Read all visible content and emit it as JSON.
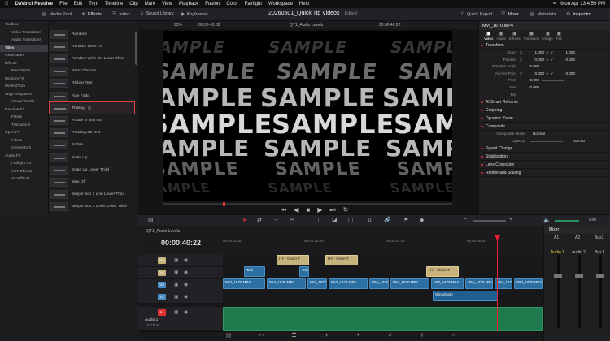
{
  "menubar": {
    "app": "DaVinci Resolve",
    "items": [
      "File",
      "Edit",
      "Trim",
      "Timeline",
      "Clip",
      "Mark",
      "View",
      "Playback",
      "Fusion",
      "Color",
      "Fairlight",
      "Workspace",
      "Help"
    ],
    "datetime": "Mon Apr 13  4:59 PM"
  },
  "toolbar": {
    "media_pool": "Media Pool",
    "effects": "Effects",
    "index": "Index",
    "sound_library": "Sound Library",
    "keyframes": "Keyframes",
    "project": "20260501_Quick Tip Videos",
    "edited": "Edited",
    "quick_export": "Quick Export",
    "mixer": "Mixer",
    "metadata": "Metadata",
    "inspector": "Inspector"
  },
  "fx_tree": [
    {
      "label": "Toolbox",
      "sub": false,
      "sel": false
    },
    {
      "label": "Video Transitions",
      "sub": true,
      "sel": false
    },
    {
      "label": "Audio Transitions",
      "sub": true,
      "sel": false
    },
    {
      "label": "Titles",
      "sub": false,
      "sel": true
    },
    {
      "label": "Generators",
      "sub": false,
      "sel": false
    },
    {
      "label": "Effects",
      "sub": false,
      "sel": false
    },
    {
      "label": "Brenderize",
      "sub": true,
      "sel": false
    },
    {
      "label": "MotionVFX",
      "sub": false,
      "sel": false
    },
    {
      "label": "MoTextTurn",
      "sub": false,
      "sel": false
    },
    {
      "label": "WippTemplates",
      "sub": false,
      "sel": false
    },
    {
      "label": "Visual Words",
      "sub": true,
      "sel": false
    },
    {
      "label": "Resolve FX",
      "sub": false,
      "sel": false
    },
    {
      "label": "Filters",
      "sub": true,
      "sel": false
    },
    {
      "label": "Transitions",
      "sub": true,
      "sel": false
    },
    {
      "label": "Open FX",
      "sub": false,
      "sel": false
    },
    {
      "label": "Filters",
      "sub": true,
      "sel": false
    },
    {
      "label": "Generators",
      "sub": true,
      "sel": false
    },
    {
      "label": "Audio FX",
      "sub": false,
      "sel": false
    },
    {
      "label": "Fairlight FX",
      "sub": true,
      "sel": false
    },
    {
      "label": "VST Effects",
      "sub": true,
      "sel": false
    },
    {
      "label": "AU Effects",
      "sub": true,
      "sel": false
    }
  ],
  "fx_items": [
    "Rainbow",
    "Random Write On",
    "Random Write On Lower Third",
    "Retro Chrome",
    "Ribbon Text",
    "Rise Fade",
    "Rolling",
    "Rotate In and Out",
    "Rotating 3D Text",
    "Rotten",
    "Scale Up",
    "Scale Up Lower Third",
    "Sign Off",
    "Simple Box 1 Line Lower Third",
    "Simple Box 2 Lines Lower Third"
  ],
  "viewer": {
    "zoom": "95%",
    "tc_left": "00:00:45:02",
    "timeline_name": "QT1_Audio Levels",
    "tc_right": "00:00:40:22",
    "sample_word": "SAMPLE"
  },
  "inspector": {
    "clip": "MVI_1670.MP4",
    "tabs": [
      "Video",
      "Audio",
      "Effects",
      "Transition",
      "Image",
      "File"
    ],
    "transform": "Transform",
    "props": [
      {
        "label": "Zoom",
        "x": "X",
        "v1": "1.000",
        "y": "Y",
        "v2": "1.000"
      },
      {
        "label": "Position",
        "x": "X",
        "v1": "0.000",
        "y": "Y",
        "v2": "0.000"
      },
      {
        "label": "Rotation Angle",
        "v1": "0.000"
      },
      {
        "label": "Anchor Point",
        "x": "X",
        "v1": "0.000",
        "y": "Y",
        "v2": "0.000"
      },
      {
        "label": "Pitch",
        "v1": "0.000"
      },
      {
        "label": "Yaw",
        "v1": "0.000"
      },
      {
        "label": "Flip"
      }
    ],
    "sections": [
      "AI Smart Reframe",
      "Cropping",
      "Dynamic Zoom",
      "Composite"
    ],
    "composite_mode_label": "Composite Mode",
    "composite_mode": "Normal",
    "opacity_label": "Opacity",
    "opacity": "100.00",
    "more_sections": [
      "Speed Change",
      "Stabilization",
      "Lens Correction",
      "Retime and Scaling"
    ]
  },
  "timeline": {
    "timecode": "00:00:40:22",
    "name": "QT1_Audio Levels",
    "ruler": [
      "00:00:00:00",
      "00:00:12:00",
      "00:00:24:00",
      "00:00:36:00"
    ],
    "tracks": [
      {
        "id": "V5",
        "color": "#c7b27b"
      },
      {
        "id": "V4",
        "color": "#c7b27b"
      },
      {
        "id": "V3",
        "color": "#4a8fc4"
      },
      {
        "id": "V2",
        "color": "#4a8fc4"
      },
      {
        "id": "V1",
        "color": "#4a8fc4"
      },
      {
        "id": "A1",
        "color": "#d33"
      }
    ],
    "audio_track_name": "Audio 1",
    "audio_track_clips": "10 Clips",
    "clip_labels": {
      "title1": "HY - Clean T",
      "title2": "HY - Clean T",
      "title3": "HY - Clean T",
      "talk": "Talk",
      "video": "MVI_1670.MP4",
      "wipp": "WippZoom"
    }
  },
  "mixer": {
    "title": "Mixer",
    "channels": [
      "A1",
      "A2",
      "Bus1"
    ],
    "subs": [
      "Audio 1",
      "Audio 2",
      "Bus 1"
    ],
    "dim": "Dim"
  }
}
